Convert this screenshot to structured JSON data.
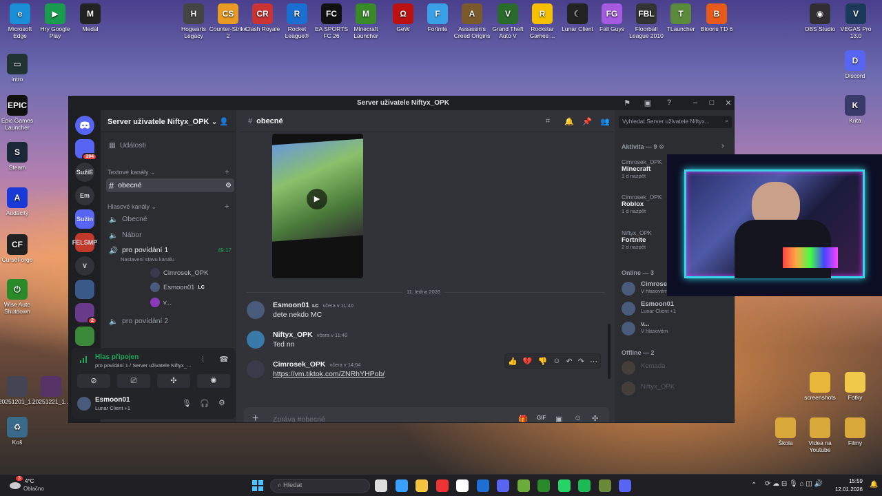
{
  "desktop": {
    "icons_top": [
      {
        "label": "Microsoft Edge",
        "glyph": "e",
        "color": "#1a8fd8"
      },
      {
        "label": "Hry Google Play",
        "glyph": "▶",
        "color": "#1a9c4f"
      },
      {
        "label": "Medal",
        "glyph": "M",
        "color": "#222"
      },
      {
        "label": "Hogwarts Legacy",
        "glyph": "H",
        "color": "#444"
      },
      {
        "label": "Counter-Strike 2",
        "glyph": "CS",
        "color": "#e89a22"
      },
      {
        "label": "Clash Royale",
        "glyph": "CR",
        "color": "#c33"
      },
      {
        "label": "Rocket League®",
        "glyph": "R",
        "color": "#1b6fd1"
      },
      {
        "label": "EA SPORTS FC 26",
        "glyph": "FC",
        "color": "#111"
      },
      {
        "label": "Minecraft Launcher",
        "glyph": "M",
        "color": "#3a8a2a"
      },
      {
        "label": "GeW",
        "glyph": "Ω",
        "color": "#b11"
      },
      {
        "label": "Fortnite",
        "glyph": "F",
        "color": "#3aa0e6"
      },
      {
        "label": "Assassin's Creed Origins",
        "glyph": "A",
        "color": "#7a5a2a"
      },
      {
        "label": "Grand Theft Auto V",
        "glyph": "V",
        "color": "#2a6a2a"
      },
      {
        "label": "Rockstar Games ...",
        "glyph": "R",
        "color": "#f5c000"
      },
      {
        "label": "Lunar Client",
        "glyph": "☾",
        "color": "#222"
      },
      {
        "label": "Fall Guys",
        "glyph": "FG",
        "color": "#a55adf"
      },
      {
        "label": "Floorball League 2010",
        "glyph": "FBL",
        "color": "#333"
      },
      {
        "label": "TLauncher",
        "glyph": "T",
        "color": "#5a8a3a"
      },
      {
        "label": "Bloons TD 6",
        "glyph": "B",
        "color": "#e85a1a"
      },
      {
        "label": "OBS Studio",
        "glyph": "◉",
        "color": "#302e31"
      },
      {
        "label": "VEGAS Pro 13.0",
        "glyph": "V",
        "color": "#1b3a5a"
      }
    ],
    "icons_left": [
      {
        "label": "intro",
        "glyph": "▭",
        "color": "#233"
      },
      {
        "label": "Epic Games Launcher",
        "glyph": "EPIC",
        "color": "#111"
      },
      {
        "label": "Steam",
        "glyph": "S",
        "color": "#1b2838"
      },
      {
        "label": "Audacity",
        "glyph": "A",
        "color": "#1a3ad8"
      },
      {
        "label": "CurseForge",
        "glyph": "CF",
        "color": "#222"
      },
      {
        "label": "Wise Auto Shutdown",
        "glyph": "⏻",
        "color": "#2a8a2a"
      },
      {
        "label": "20251201_1...",
        "glyph": "",
        "color": "#445"
      },
      {
        "label": "20251221_1...",
        "glyph": "",
        "color": "#536"
      },
      {
        "label": "Koš",
        "glyph": "♻",
        "color": "#3a6a8a"
      }
    ],
    "icons_right": [
      {
        "label": "Discord",
        "glyph": "D",
        "color": "#5865f2"
      },
      {
        "label": "Krita",
        "glyph": "K",
        "color": "#3a3a6a"
      },
      {
        "label": "screenshots",
        "glyph": "",
        "color": "#e8b83a"
      },
      {
        "label": "Fotky",
        "glyph": "",
        "color": "#f0c84a"
      },
      {
        "label": "Škola",
        "glyph": "",
        "color": "#d8a83a"
      },
      {
        "label": "Videa na Youtube",
        "glyph": "",
        "color": "#d8a83a"
      },
      {
        "label": "Filmy",
        "glyph": "",
        "color": "#d8a83a"
      }
    ]
  },
  "window": {
    "title": "Server uživatele Niftyx_OPK"
  },
  "guilds": [
    {
      "label": "",
      "badge": "394",
      "color": "#5865f2"
    },
    {
      "label": "SužiE",
      "badge": "",
      "color": "#313338"
    },
    {
      "label": "Em",
      "badge": "",
      "color": "#313338"
    },
    {
      "label": "Sužin",
      "badge": "",
      "color": "#5865f2"
    },
    {
      "label": "FELSMP",
      "badge": "",
      "color": "#c0392b"
    },
    {
      "label": "V",
      "badge": "",
      "color": "#313338"
    },
    {
      "label": "",
      "badge": "",
      "color": "#3a5a8a"
    },
    {
      "label": "",
      "badge": "2",
      "color": "#6a3a8a"
    },
    {
      "label": "",
      "badge": "",
      "color": "#3a8a3a"
    },
    {
      "label": "",
      "badge": "",
      "color": "#555"
    }
  ],
  "sidebar": {
    "server_name": "Server uživatele Niftyx_OPK",
    "events": "Události",
    "text_category": "Textové kanály",
    "text_channels": [
      "obecné"
    ],
    "voice_category": "Hlasové kanály",
    "voice_channels": [
      "Obecné",
      "Nábor",
      "pro povídání 1",
      "pro povídání 2"
    ],
    "voice_status": "Nastavení stavu kanálu",
    "voice_timer": "49:17",
    "voice_users": [
      "Cimrosek_OPK",
      "Esmoon01",
      "v..."
    ],
    "voice_user_tag": "LC"
  },
  "voice_panel": {
    "status": "Hlas připojen",
    "location": "pro povídání 1 / Server uživatele Niftyx_...",
    "user": "Esmoon01",
    "user_status": "Lunar Client +1"
  },
  "chat": {
    "channel": "obecné",
    "date_divider": "11. ledna 2026",
    "messages": [
      {
        "author": "Esmoon01",
        "tag": "LC",
        "time": "včera v 11:40",
        "text": "dete nekdo MC",
        "avatar_color": "#4a5a7a"
      },
      {
        "author": "Niftyx_OPK",
        "tag": "",
        "time": "včera v 11:40",
        "text": "Ted nn",
        "avatar_color": "#3a7aa8"
      },
      {
        "author": "Cimrosek_OPK",
        "tag": "",
        "time": "včera v 14:04",
        "text": "https://vm.tiktok.com/ZNRhYHPob/",
        "avatar_color": "#3a3a4a"
      }
    ],
    "composer_placeholder": "Zpráva #obecné",
    "search_placeholder": "Vyhledat Server uživatele Niftyx..."
  },
  "members": {
    "activity_header": "Aktivita — 9",
    "activities": [
      {
        "name": "Cimrosek_OPK",
        "game": "Minecraft",
        "ago": "1 d nazpět"
      },
      {
        "name": "Cimrosek_OPK",
        "game": "Roblox",
        "ago": "1 d nazpět"
      },
      {
        "name": "Niftyx_OPK",
        "game": "Fortnite",
        "ago": "2 d nazpět"
      }
    ],
    "online_header": "Online — 3",
    "online": [
      {
        "name": "Cimrosek_OPK",
        "status": "V hlasovém"
      },
      {
        "name": "Esmoon01",
        "status": "Lunar Client +1"
      },
      {
        "name": "v...",
        "status": "V hlasovém"
      }
    ],
    "offline_header": "Offline — 2",
    "offline": [
      "Kemada",
      "Niftyx_OPK"
    ]
  },
  "taskbar": {
    "weather_temp": "4°C",
    "weather_desc": "Oblačno",
    "weather_badge": "3",
    "search_placeholder": "Hledat",
    "time": "15:59",
    "date": "12.01.2026"
  }
}
